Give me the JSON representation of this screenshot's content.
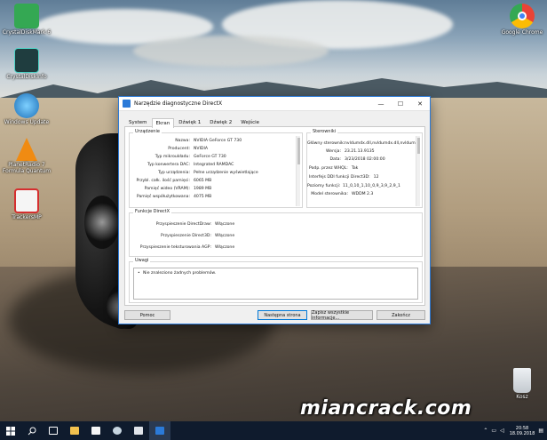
{
  "desktop": {
    "icons": [
      {
        "label": "CrystalDiskMark 6",
        "color": "#34a853"
      },
      {
        "label": "CrystalDiskInfo",
        "color": "#1f3d3f"
      },
      {
        "label": "Windows Update",
        "color": "#2c8bd6"
      },
      {
        "label": "PlanetRadio 7 Formula Quantum",
        "color": "#f08b12"
      },
      {
        "label": "TrackersMP",
        "color": "#d52f2f"
      },
      {
        "label": "Google Chrome",
        "color": "#4285f4"
      },
      {
        "label": "Kosz",
        "color": "#d9dde2"
      }
    ]
  },
  "window": {
    "title": "Narzędzie diagnostyczne DirectX",
    "controls": {
      "minimize": "—",
      "maximize": "☐",
      "close": "✕"
    },
    "tabs": [
      "System",
      "Ekran",
      "Dźwięk 1",
      "Dźwięk 2",
      "Wejście"
    ],
    "active_tab": "Ekran",
    "device": {
      "legend": "Urządzenie",
      "rows": [
        {
          "k": "Nazwa:",
          "v": "NVIDIA GeForce GT 730"
        },
        {
          "k": "Producent:",
          "v": "NVIDIA"
        },
        {
          "k": "Typ mikroukładu:",
          "v": "GeForce GT 730"
        },
        {
          "k": "Typ konwertera DAC:",
          "v": "Integrated RAMDAC"
        },
        {
          "k": "Typ urządzenia:",
          "v": "Pełne urządzenie wyświetlające"
        },
        {
          "k": "Przybl. całk. ilość pamięci:",
          "v": "6065 MB"
        },
        {
          "k": "Pamięć wideo (VRAM):",
          "v": "1989 MB"
        },
        {
          "k": "Pamięć współużytkowana:",
          "v": "4075 MB"
        }
      ]
    },
    "drivers": {
      "legend": "Sterowniki",
      "rows": [
        {
          "k": "Główny sterownik:",
          "v": "nvldumdx.dll,nvldumdx.dll,nvldum"
        },
        {
          "k": "Wersja:",
          "v": "23.21.13.9135"
        },
        {
          "k": "Data:",
          "v": "3/23/2018 02:00:00"
        },
        {
          "k": "Podp. przez WHQL:",
          "v": "Tak"
        },
        {
          "k": "Interfejs DDI funkcji Direct3D:",
          "v": "12"
        },
        {
          "k": "Poziomy funkcji:",
          "v": "11_0,10_1,10_0,9_3,9_2,9_1"
        },
        {
          "k": "Model sterownika:",
          "v": "WDDM 2.3"
        }
      ]
    },
    "features": {
      "legend": "Funkcje DirectX",
      "rows": [
        {
          "k": "Przyspieszenie DirectDraw:",
          "v": "Włączone"
        },
        {
          "k": "Przyspieszenie Direct3D:",
          "v": "Włączone"
        },
        {
          "k": "Przyspieszenie teksturowania AGP:",
          "v": "Włączone"
        }
      ]
    },
    "notes": {
      "legend": "Uwagi",
      "items": [
        "Nie znaleziono żadnych problemów."
      ]
    },
    "buttons": {
      "help": "Pomoc",
      "next_page": "Następna strona",
      "save_all": "Zapisz wszystkie informacje...",
      "exit": "Zakończ"
    }
  },
  "taskbar": {
    "time": "20:58",
    "date": "18.09.2018"
  },
  "watermark": "miancrack.com"
}
